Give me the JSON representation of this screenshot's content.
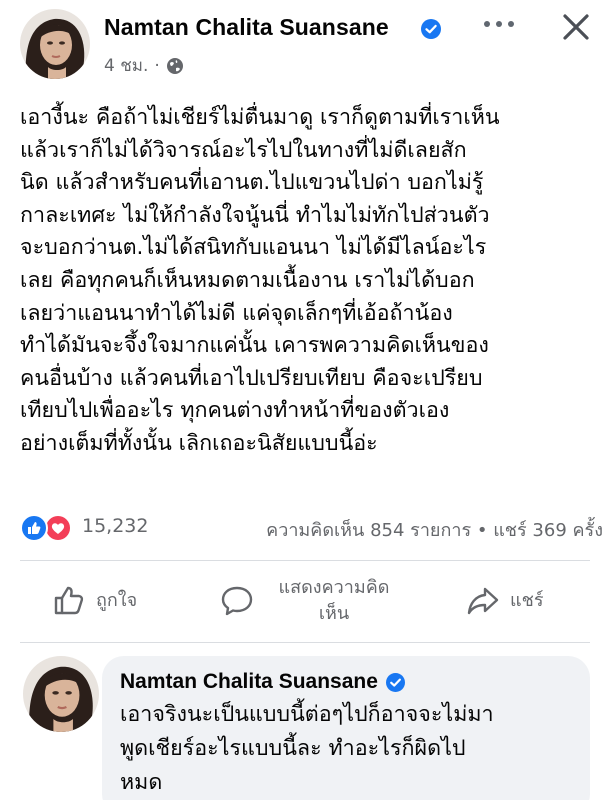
{
  "post": {
    "author": "Namtan Chalita Suansane",
    "timestamp": "4 ชม.",
    "separator": "·",
    "body_lines": [
      "เอางี้นะ คือถ้าไม่เชียร์ไม่ตื่นมาดู เราก็ดูตามที่เราเห็น",
      "แล้วเราก็ไม่ได้วิจารณ์อะไรไปในทางที่ไม่ดีเลยสัก",
      "นิด แล้วสำหรับคนที่เอานต.ไปแขวนไปด่า บอกไม่รู้",
      "กาละเทศะ ไม่ให้กำลังใจนู้นนี่ ทำไมไม่ทักไปส่วนตัว",
      "จะบอกว่านต.ไม่ได้สนิทกับแอนนา ไม่ได้มีไลน์อะไร",
      "เลย คือทุกคนก็เห็นหมดตามเนื้องาน เราไม่ได้บอก",
      "เลยว่าแอนนาทำได้ไม่ดี แค่จุดเล็กๆที่เอ้อถ้าน้อง",
      "ทำได้มันจะจึ้งใจมากแค่นั้น เคารพความคิดเห็นของ",
      "คนอื่นบ้าง แล้วคนที่เอาไปเปรียบเทียบ คือจะเปรียบ",
      "เทียบไปเพื่ออะไร ทุกคนต่างทำหน้าที่ของตัวเอง",
      "อย่างเต็มที่ทั้งนั้น เลิกเถอะนิสัยแบบนี้อ่ะ"
    ],
    "reaction_count": "15,232",
    "stats": "ความคิดเห็น 854 รายการ • แชร์ 369 ครั้ง"
  },
  "actions": {
    "like_label": "ถูกใจ",
    "comment_label": "แสดงความคิดเห็น",
    "share_label": "แชร์"
  },
  "comment": {
    "author": "Namtan Chalita Suansane",
    "text_lines": [
      "เอาจริงนะเป็นแบบนี้ต่อๆไปก็อาจจะไม่มา",
      "พูดเชียร์อะไรแบบนี้ละ ทำอะไรก็ผิดไป",
      "หมด"
    ]
  },
  "icons": {
    "verified": "verified-badge-icon",
    "audience": "globe-icon",
    "more": "more-options-icon",
    "close": "close-icon",
    "like": "like-thumb-icon",
    "love": "heart-icon",
    "comment": "comment-bubble-icon",
    "share": "share-arrow-icon"
  },
  "colors": {
    "brand_blue": "#1877f2",
    "love_red": "#f33e58",
    "secondary_text": "#65676b",
    "comment_bg": "#f0f2f5"
  }
}
